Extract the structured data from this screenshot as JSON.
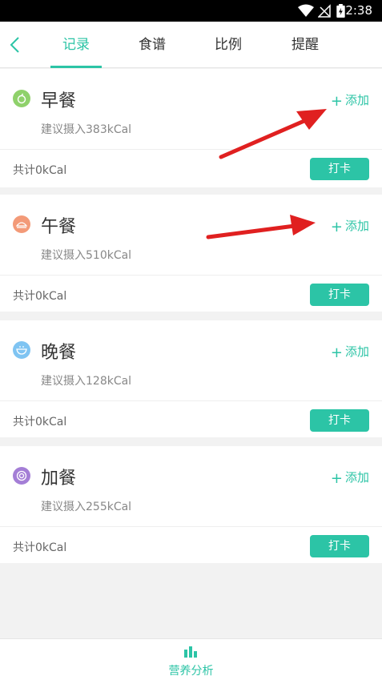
{
  "status_bar": {
    "time": "2:38",
    "icons": [
      "wifi-icon",
      "no-signal-icon",
      "battery-charging-icon"
    ]
  },
  "top_nav": {
    "back_icon": "chevron-left-icon",
    "tabs": [
      {
        "label": "记录",
        "active": true
      },
      {
        "label": "食谱",
        "active": false
      },
      {
        "label": "比例",
        "active": false
      },
      {
        "label": "提醒",
        "active": false
      }
    ]
  },
  "meals": [
    {
      "name": "早餐",
      "suggest": "建议摄入383kCal",
      "add_label": "添加",
      "total": "共计0kCal",
      "punch_label": "打卡",
      "icon": "apple-icon",
      "icon_color": "#8fd16b"
    },
    {
      "name": "午餐",
      "suggest": "建议摄入510kCal",
      "add_label": "添加",
      "total": "共计0kCal",
      "punch_label": "打卡",
      "icon": "dish-icon",
      "icon_color": "#f39a78"
    },
    {
      "name": "晚餐",
      "suggest": "建议摄入128kCal",
      "add_label": "添加",
      "total": "共计0kCal",
      "punch_label": "打卡",
      "icon": "bowl-icon",
      "icon_color": "#7fc4f2"
    },
    {
      "name": "加餐",
      "suggest": "建议摄入255kCal",
      "add_label": "添加",
      "total": "共计0kCal",
      "punch_label": "打卡",
      "icon": "donut-icon",
      "icon_color": "#a47ed6"
    }
  ],
  "bottom_nav": {
    "icon": "bar-chart-icon",
    "label": "营养分析"
  },
  "colors": {
    "accent": "#2cc4a6",
    "annotation_arrow": "#e02020"
  }
}
